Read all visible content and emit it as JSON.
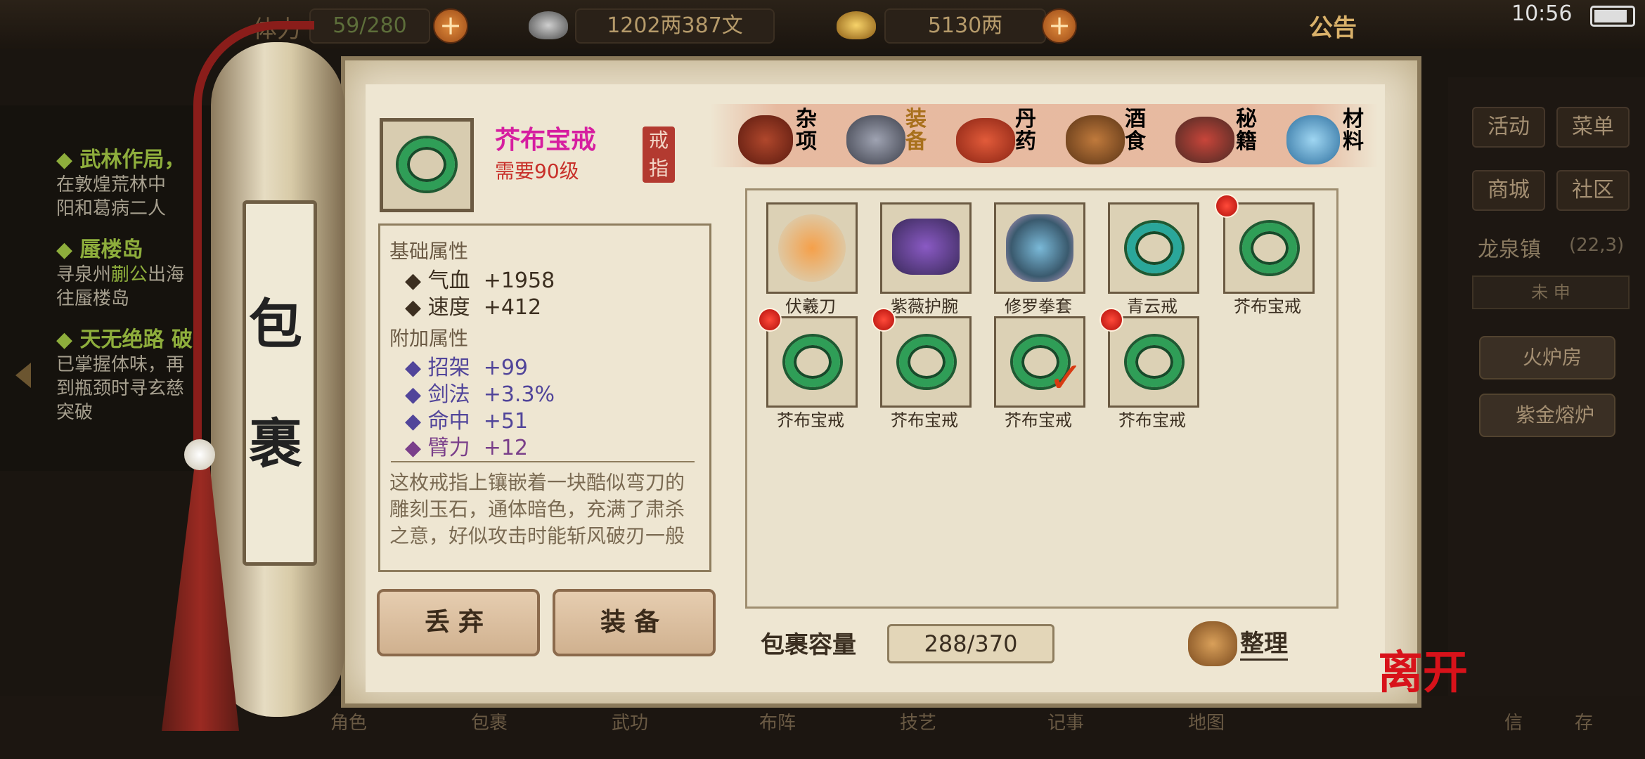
{
  "topbar": {
    "stamina_label": "体力",
    "stamina_value": "59/280",
    "silver": "1202两387文",
    "gold": "5130两",
    "plus": "+",
    "notice": "公告",
    "clock": "10:56"
  },
  "quests": [
    {
      "title": "武林作局，",
      "text1": "在敦煌荒林中",
      "text2": "阳和葛病二人"
    },
    {
      "title": "蜃楼岛",
      "text1a": "寻泉州",
      "highlight": "蒯公",
      "text1b": "出海",
      "text2": "往蜃楼岛"
    },
    {
      "title": "天无绝路 破",
      "text1": "已掌握体味，再",
      "text2": "到瓶颈时寻玄慈",
      "text3": "突破"
    }
  ],
  "right_panel": {
    "btn_activity": "活动",
    "btn_menu": "菜单",
    "btn_shop": "商城",
    "btn_community": "社区",
    "location": "龙泉镇",
    "coords": "(22,3)",
    "time_marks": "未  申",
    "item1": "火炉房",
    "item2": "紫金熔炉"
  },
  "bottom_nav": [
    "角色",
    "包裹",
    "武功",
    "布阵",
    "技艺",
    "记事",
    "地图",
    "信",
    "存"
  ],
  "scroll_title": [
    "包",
    "裹"
  ],
  "item": {
    "name": "芥布宝戒",
    "requirement": "需要90级",
    "type": "戒指"
  },
  "attributes": {
    "base_header": "基础属性",
    "base": [
      {
        "name": "气血",
        "value": "+1958"
      },
      {
        "name": "速度",
        "value": "+412"
      }
    ],
    "extra_header": "附加属性",
    "extra": [
      {
        "name": "招架",
        "value": "+99"
      },
      {
        "name": "剑法",
        "value": "+3.3%"
      },
      {
        "name": "命中",
        "value": "+51"
      },
      {
        "name": "臂力",
        "value": "+12"
      }
    ],
    "description": "这枚戒指上镶嵌着一块酷似弯刀的雕刻玉石，通体暗色，充满了肃杀之意，好似攻击时能斩风破刃一般"
  },
  "buttons": {
    "discard": "丢弃",
    "equip": "装备",
    "sort": "整理",
    "leave": "离开"
  },
  "tabs": [
    {
      "label": "杂项",
      "color": "#2b1f14",
      "icon": "jar-icon"
    },
    {
      "label": "装备",
      "color": "#a8701c",
      "icon": "equipment-icon"
    },
    {
      "label": "丹药",
      "color": "#2b1f14",
      "icon": "pills-icon"
    },
    {
      "label": "酒食",
      "color": "#2b1f14",
      "icon": "food-icon"
    },
    {
      "label": "秘籍",
      "color": "#2b1f14",
      "icon": "book-icon"
    },
    {
      "label": "材料",
      "color": "#2b1f14",
      "icon": "crystal-icon"
    }
  ],
  "inventory": [
    {
      "name": "伏羲刀",
      "icon": "blade-icon",
      "dot": false,
      "checked": false
    },
    {
      "name": "紫薇护腕",
      "icon": "bracer-icon",
      "dot": false,
      "checked": false
    },
    {
      "name": "修罗拳套",
      "icon": "gauntlet-icon",
      "dot": false,
      "checked": false
    },
    {
      "name": "青云戒",
      "icon": "ring-icon",
      "dot": false,
      "checked": false
    },
    {
      "name": "芥布宝戒",
      "icon": "ring-icon",
      "dot": true,
      "checked": false
    },
    {
      "name": "芥布宝戒",
      "icon": "ring-icon",
      "dot": true,
      "checked": false
    },
    {
      "name": "芥布宝戒",
      "icon": "ring-icon",
      "dot": true,
      "checked": false
    },
    {
      "name": "芥布宝戒",
      "icon": "ring-icon",
      "dot": false,
      "checked": true
    },
    {
      "name": "芥布宝戒",
      "icon": "ring-icon",
      "dot": true,
      "checked": false
    }
  ],
  "capacity": {
    "label": "包裹容量",
    "value": "288/370"
  }
}
